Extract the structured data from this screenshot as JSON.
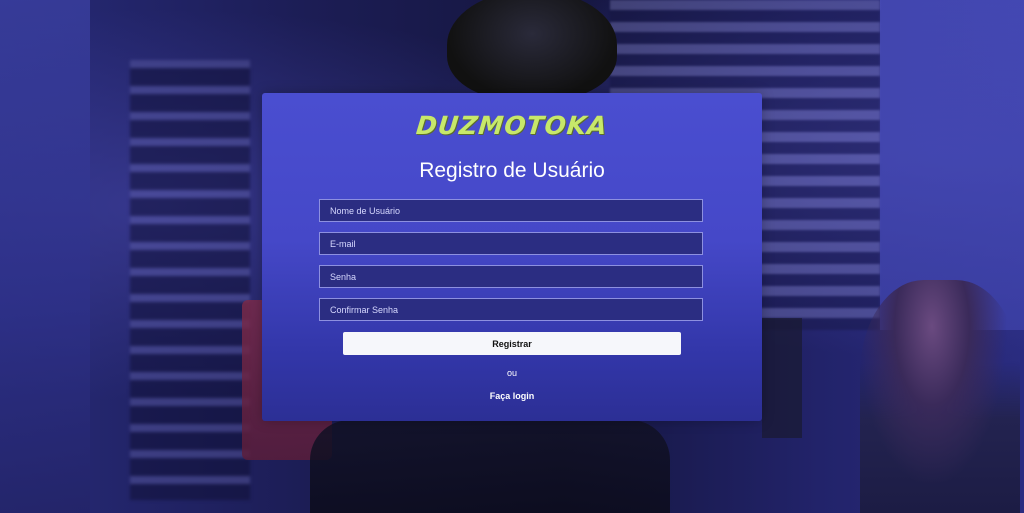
{
  "brand": {
    "logo_text": "DUZMOTOKA",
    "logo_color": "#c7e86a"
  },
  "form": {
    "title": "Registro de Usuário",
    "fields": {
      "username_placeholder": "Nome de Usuário",
      "email_placeholder": "E-mail",
      "password_placeholder": "Senha",
      "confirm_password_placeholder": "Confirmar Senha"
    },
    "submit_label": "Registrar",
    "separator_text": "ou",
    "login_link_text": "Faça login"
  },
  "colors": {
    "card_accent": "#4a4ed0",
    "input_background": "#2b2d82",
    "button_background": "#f6f7fb"
  }
}
